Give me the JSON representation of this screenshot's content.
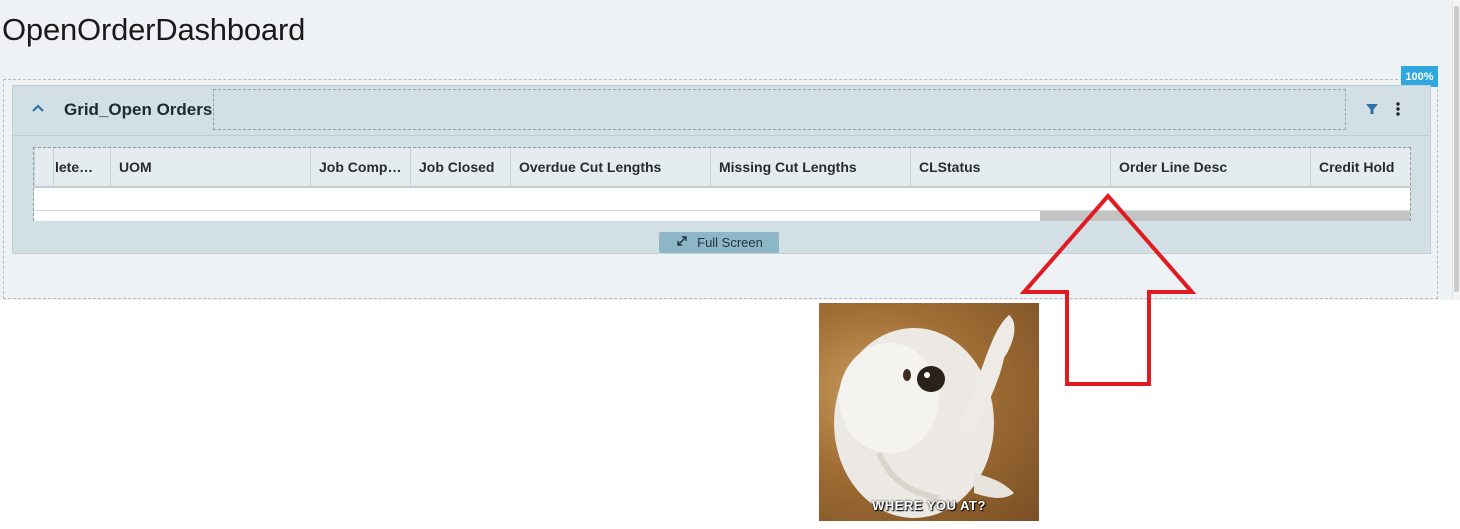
{
  "page": {
    "title": "OpenOrderDashboard",
    "zoom_badge": "100%"
  },
  "panel": {
    "title": "Grid_Open Orders"
  },
  "grid": {
    "columns": [
      {
        "label": "lete…"
      },
      {
        "label": "UOM"
      },
      {
        "label": "Job Comp…"
      },
      {
        "label": "Job Closed"
      },
      {
        "label": "Overdue Cut Lengths"
      },
      {
        "label": "Missing Cut Lengths"
      },
      {
        "label": "CLStatus"
      },
      {
        "label": "Order Line Desc"
      },
      {
        "label": "Credit Hold"
      }
    ]
  },
  "buttons": {
    "full_screen": "Full Screen"
  },
  "meme": {
    "caption": "WHERE YOU AT?"
  },
  "colors": {
    "accent": "#2b73a8",
    "badge": "#2fa8e0",
    "arrow": "#e01b22"
  },
  "icons": {
    "collapse": "chevron-up-icon",
    "filter": "filter-icon",
    "more": "more-vertical-icon",
    "expand": "expand-icon"
  }
}
